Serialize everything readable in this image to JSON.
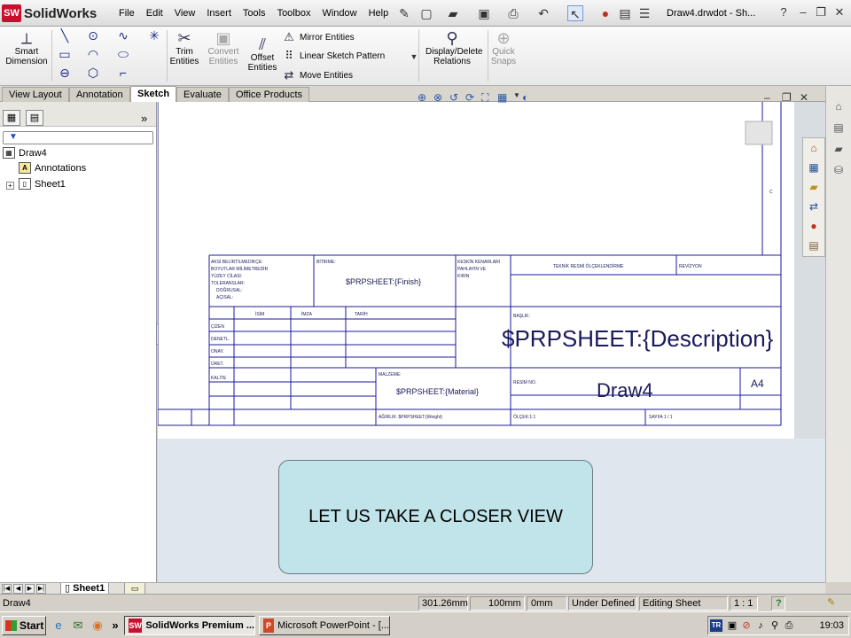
{
  "app": {
    "logo_mark": "SW",
    "logo_text": "SolidWorks",
    "menus": [
      "File",
      "Edit",
      "View",
      "Insert",
      "Tools",
      "Toolbox",
      "Window",
      "Help"
    ],
    "document_title": "Draw4.drwdot - Sh..."
  },
  "toolbar_icons": [
    "pushpin-icon",
    "new-document-icon",
    "open-folder-icon",
    "save-icon",
    "print-icon",
    "undo-icon",
    "select-arrow-icon",
    "rebuild-traffic-light-icon",
    "file-properties-icon",
    "options-icon"
  ],
  "command_manager": {
    "smart_dimension": "Smart Dimension",
    "trim_entities": "Trim Entities",
    "convert_entities": "Convert Entities",
    "offset_entities": "Offset Entities",
    "mirror_entities": "Mirror Entities",
    "linear_sketch_pattern": "Linear Sketch Pattern",
    "move_entities": "Move Entities",
    "display_delete_relations": "Display/Delete Relations",
    "quick_snaps": "Quick Snaps"
  },
  "tabs": [
    "View Layout",
    "Annotation",
    "Sketch",
    "Evaluate",
    "Office Products"
  ],
  "active_tab": "Sketch",
  "feature_tree": {
    "root": "Draw4",
    "items": [
      "Annotations",
      "Sheet1"
    ]
  },
  "title_block": {
    "general_notes": [
      "AKSİ BELİRTİLMEDİKÇE:",
      "BOYUTLAR MİLİMETREDİR",
      "YÜZEY CİLASI:",
      "TOLERANSLAR:",
      "DOĞRUSAL:",
      "AÇISAL:"
    ],
    "finish_label": "BİTİRME:",
    "finish_value": "$PRPSHEET:{Finish}",
    "edge_notes": [
      "KESKİN KENARLARI",
      "PAHLAYIN VE",
      "KIRIN"
    ],
    "header_dont_scale": "TEKNİK RESMİ ÖLÇEKLENDİRME",
    "header_revision": "REVİZYON",
    "col_headers": [
      "İSİM",
      "İMZA",
      "TARİH"
    ],
    "row_labels": [
      "ÇİZEN",
      "DENETL.",
      "ONAY.",
      "ÜRET.",
      "KALİTE"
    ],
    "title_label": "BAŞLIK:",
    "description": "$PRPSHEET:{Description}",
    "material_label": "MALZEME:",
    "material_value": "$PRPSHEET:{Material}",
    "drawing_no_label": "RESİM NO.",
    "drawing_no": "Draw4",
    "size": "A4",
    "weight": "AĞIRLIK: $PRPSHEET:{Weight}",
    "scale": "ÖLÇEK:1:1",
    "sheet": "SAYFA 1 / 1",
    "zone_marker": "C"
  },
  "callout": "LET US TAKE A CLOSER VIEW",
  "sheet_tabs": {
    "active": "Sheet1"
  },
  "status_bar": {
    "document": "Draw4",
    "x": "301.26mm",
    "y": "100mm",
    "z": "0mm",
    "state": "Under Defined",
    "mode": "Editing Sheet Format",
    "scale": "1 : 1",
    "help": "?"
  },
  "taskbar": {
    "start": "Start",
    "overflow": "»",
    "tasks": [
      {
        "label": "SolidWorks Premium ...",
        "icon": "SW",
        "color": "#c8102e",
        "active": true
      },
      {
        "label": "Microsoft PowerPoint - [...",
        "icon": "P",
        "color": "#d24726",
        "active": false
      }
    ],
    "tray_lang": "TR",
    "clock": "19:03"
  }
}
